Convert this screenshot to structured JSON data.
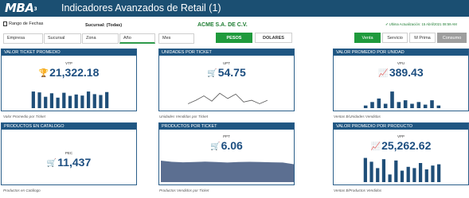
{
  "app": {
    "logo": "MBA",
    "logo_sup": "3",
    "title": "Indicadores Avanzados de Retail (1)"
  },
  "filters": {
    "date_range": "Rango de Fechas",
    "branch": "Sucursal: (Todas)",
    "company": "ACME S.A. DE C.V.",
    "last_update": "Ultima Actualización: 15 Abril/2021 08:59 AM",
    "boxes": [
      "Empresa",
      "Sucursal",
      "Zona",
      "Año",
      "Mes"
    ],
    "currency": [
      "PESOS",
      "DOLARES"
    ],
    "modes": [
      "Venta",
      "Servicio",
      "M Prima",
      "Consumo"
    ]
  },
  "cards": [
    {
      "title": "VALOR TICKET PROMEDIO",
      "code": "VTP",
      "icon": "trophy-icon",
      "glyph": "🏆",
      "value": "21,322.18",
      "footer": "Valor Promedio por Ticket"
    },
    {
      "title": "UNIDADES POR TICKET",
      "code": "UPT",
      "icon": "cart-icon",
      "glyph": "🛒",
      "value": "54.75",
      "footer": "Unidades Vendidas por Ticket"
    },
    {
      "title": "VALOR PROMEDIO POR UNIDAD",
      "code": "VPU",
      "icon": "trend-icon",
      "glyph": "📈",
      "value": "389.43",
      "footer": "Ventas $/Unidades Vendidas"
    },
    {
      "title": "PRODUCTOS EN CATALOGO",
      "code": "PEC",
      "icon": "cart-icon",
      "glyph": "🛒",
      "value": "11,437",
      "footer": "Productos en Catálogo"
    },
    {
      "title": "PRODUCTOS POR TICKET",
      "code": "PPT",
      "icon": "cart-icon",
      "glyph": "🛒",
      "value": "6.06",
      "footer": "Productos Vendidos por Ticket"
    },
    {
      "title": "VALOR PROMEDIO POR PRODUCTO",
      "code": "VPP",
      "icon": "trend-icon",
      "glyph": "📈",
      "value": "25,262.62",
      "footer": "Ventas $/Productos Vendidos"
    }
  ],
  "sparklines": {
    "vtp": [
      0.95,
      0.9,
      0.65,
      0.85,
      0.6,
      0.88,
      0.7,
      0.78,
      0.72,
      0.95,
      0.8,
      0.75,
      0.92
    ],
    "upt": [
      0.25,
      0.45,
      0.7,
      0.4,
      0.85,
      0.55,
      0.8,
      0.35,
      0.45,
      0.25,
      0.45
    ],
    "vpu": [
      0.15,
      0.35,
      0.55,
      0.25,
      0.95,
      0.35,
      0.45,
      0.25,
      0.35,
      0.2,
      0.45,
      0.15
    ],
    "ppt": [
      0.9,
      0.85,
      0.83,
      0.84,
      0.86,
      0.84,
      0.82,
      0.84,
      0.85,
      0.84,
      0.83,
      0.82,
      0.75
    ],
    "vpp": [
      0.95,
      0.8,
      0.55,
      0.9,
      0.3,
      0.85,
      0.45,
      0.6,
      0.55,
      0.75,
      0.5,
      0.65,
      0.7
    ]
  }
}
